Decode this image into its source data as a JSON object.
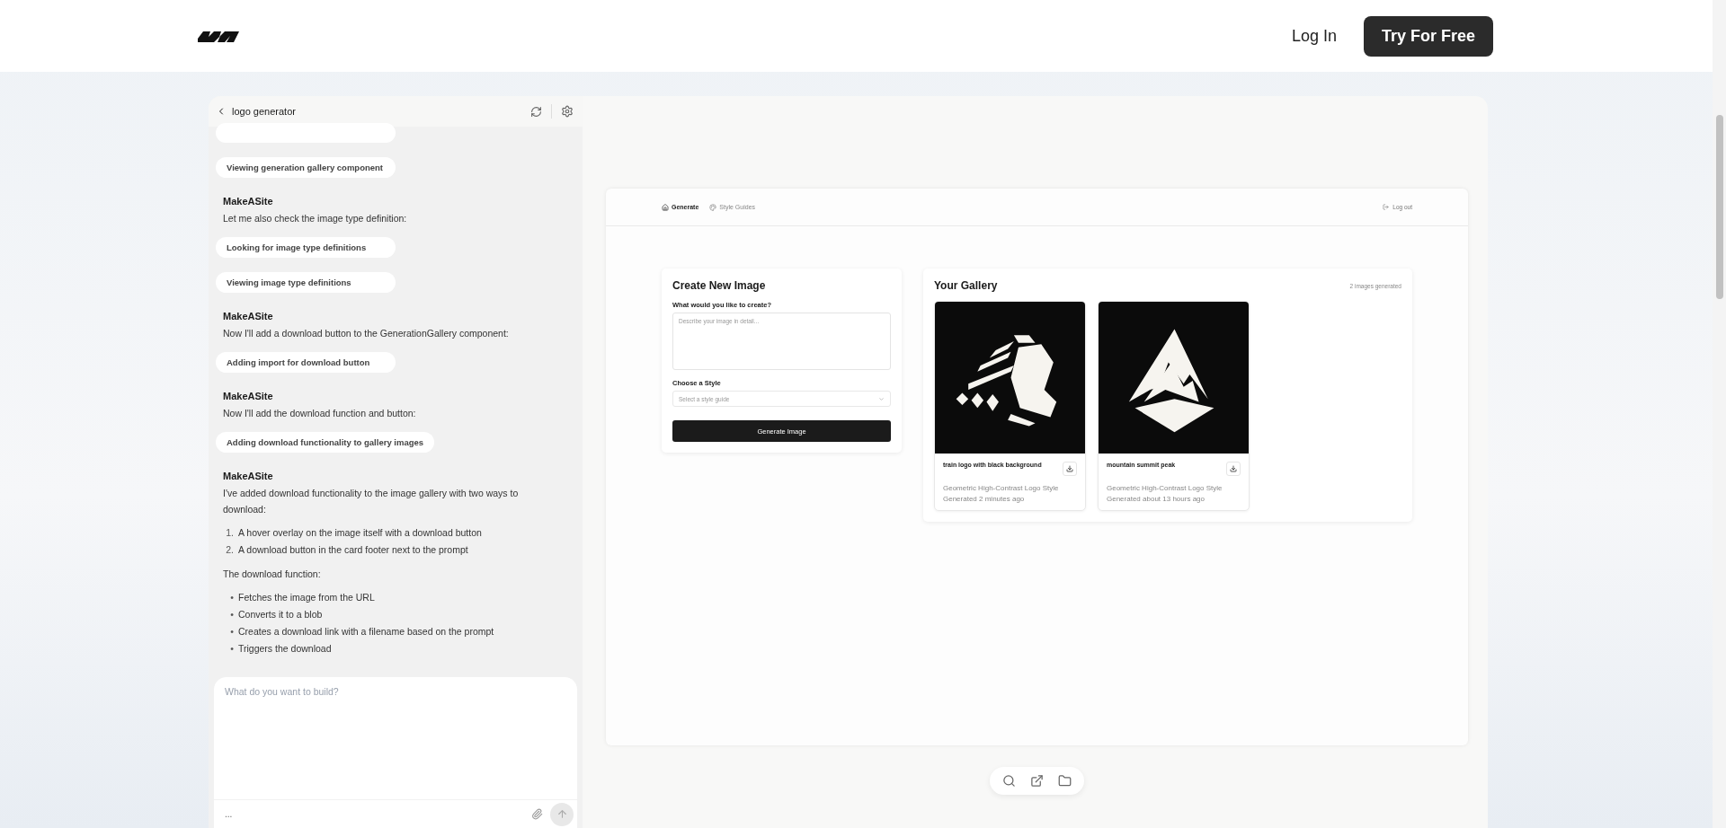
{
  "header": {
    "login": "Log In",
    "cta": "Try For Free"
  },
  "chat": {
    "title": "logo generator",
    "items": [
      {
        "kind": "chip"
      },
      {
        "kind": "chip",
        "text": "Viewing generation gallery component"
      },
      {
        "kind": "author",
        "text": "MakeASite"
      },
      {
        "kind": "text",
        "text": "Let me also check the image type definition:"
      },
      {
        "kind": "chip",
        "text": "Looking for image type definitions"
      },
      {
        "kind": "chip",
        "text": "Viewing image type definitions"
      },
      {
        "kind": "author",
        "text": "MakeASite"
      },
      {
        "kind": "text",
        "text": "Now I'll add a download button to the GenerationGallery component:"
      },
      {
        "kind": "chip",
        "text": "Adding import for download button"
      },
      {
        "kind": "author",
        "text": "MakeASite"
      },
      {
        "kind": "text",
        "text": "Now I'll add the download function and button:"
      },
      {
        "kind": "chip",
        "text": "Adding download functionality to gallery images"
      },
      {
        "kind": "author",
        "text": "MakeASite"
      },
      {
        "kind": "text",
        "text": "I've added download functionality to the image gallery with two ways to download:"
      },
      {
        "kind": "list",
        "items": [
          {
            "marker": "1.",
            "text": "A hover overlay on the image itself with a download button"
          },
          {
            "marker": "2.",
            "text": "A download button in the card footer next to the prompt"
          }
        ]
      },
      {
        "kind": "text",
        "text": "The download function:"
      },
      {
        "kind": "list",
        "items": [
          {
            "marker": "•",
            "text": "Fetches the image from the URL"
          },
          {
            "marker": "•",
            "text": "Converts it to a blob"
          },
          {
            "marker": "•",
            "text": "Creates a download link with a filename based on the prompt"
          },
          {
            "marker": "•",
            "text": "Triggers the download"
          }
        ]
      }
    ],
    "input": {
      "placeholder": "What do you want to build?",
      "more": "..."
    }
  },
  "preview": {
    "nav": [
      {
        "label": "Generate",
        "selected": true
      },
      {
        "label": "Style Guides",
        "selected": false
      }
    ],
    "logout": "Log out",
    "create": {
      "title": "Create New Image",
      "prompt_label": "What would you like to create?",
      "prompt_placeholder": "Describe your image in detail...",
      "style_label": "Choose a Style",
      "style_placeholder": "Select a style guide",
      "button": "Generate Image"
    },
    "gallery": {
      "title": "Your Gallery",
      "count": "2 images generated",
      "images": [
        {
          "prompt": "train logo with black background",
          "style": "Geometric High-Contrast Logo Style",
          "time": "Generated 2 minutes ago"
        },
        {
          "prompt": "mountain summit peak",
          "style": "Geometric High-Contrast Logo Style",
          "time": "Generated about 13 hours ago"
        }
      ]
    }
  }
}
